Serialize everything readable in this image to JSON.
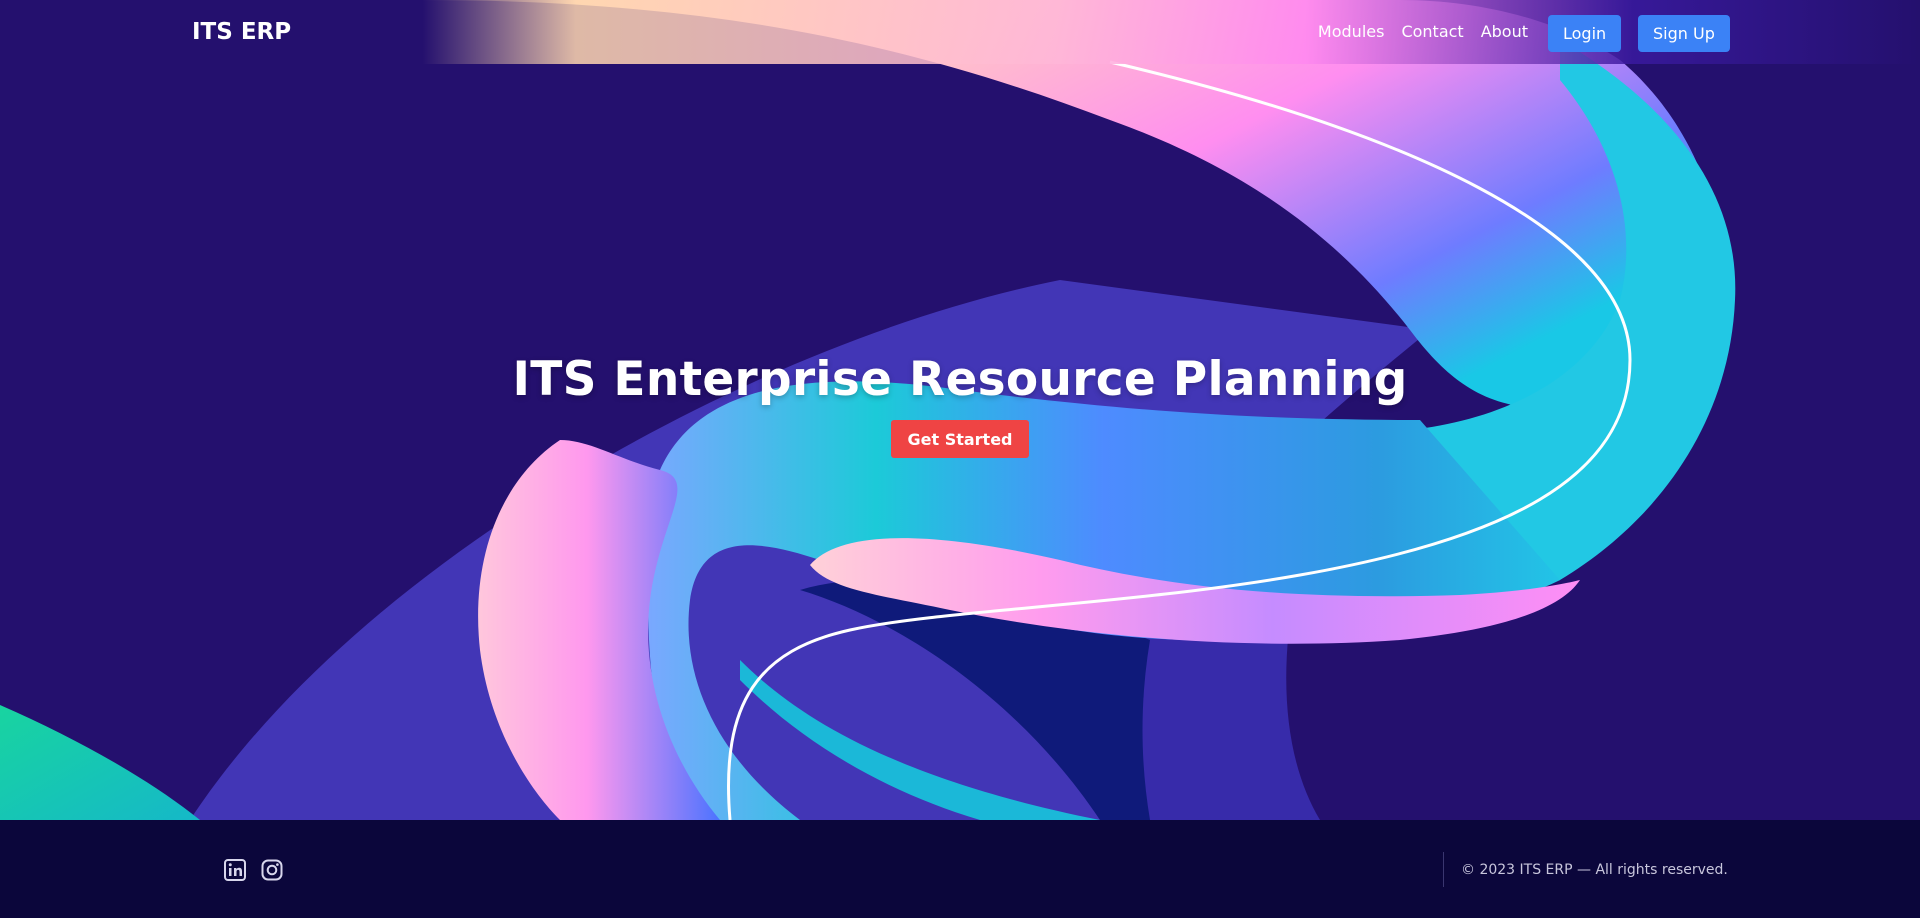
{
  "nav": {
    "brand": "ITS ERP",
    "links": [
      "Modules",
      "Contact",
      "About"
    ],
    "login_label": "Login",
    "signup_label": "Sign Up"
  },
  "hero": {
    "title": "ITS Enterprise Resource Planning",
    "cta_label": "Get Started"
  },
  "footer": {
    "social_icons": [
      "linkedin-icon",
      "instagram-icon"
    ],
    "copyright": "© 2023 ITS ERP — All rights reserved."
  },
  "colors": {
    "background": "#24106e",
    "footer_bg": "#0b063b",
    "primary_button": "#3b82f6",
    "cta_button": "#ef4444"
  }
}
